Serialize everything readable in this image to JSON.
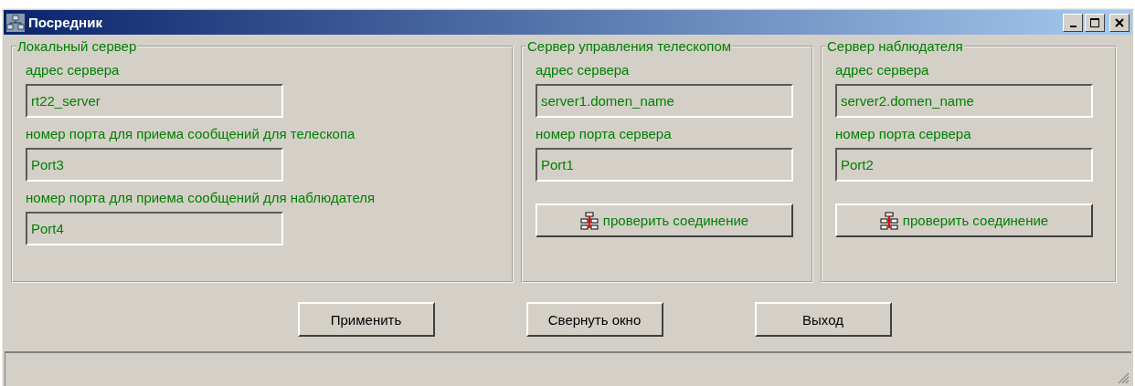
{
  "window": {
    "title": "Посредник"
  },
  "groups": [
    {
      "title": "Локальный сервер",
      "fields": [
        {
          "label": "адрес сервера",
          "value": "rt22_server"
        },
        {
          "label": "номер порта для приема сообщений для телескопа",
          "value": "Port3"
        },
        {
          "label": "номер порта для приема сообщений для наблюдателя",
          "value": "Port4"
        }
      ]
    },
    {
      "title": "Сервер управления телескопом",
      "fields": [
        {
          "label": "адрес сервера",
          "value": "server1.domen_name"
        },
        {
          "label": "номер порта сервера",
          "value": "Port1"
        }
      ],
      "button": "проверить соединение"
    },
    {
      "title": "Сервер наблюдателя",
      "fields": [
        {
          "label": "адрес сервера",
          "value": "server2.domen_name"
        },
        {
          "label": "номер порта сервера",
          "value": "Port2"
        }
      ],
      "button": "проверить соединение"
    }
  ],
  "buttons": [
    "Применить",
    "Свернуть окно",
    "Выход"
  ]
}
